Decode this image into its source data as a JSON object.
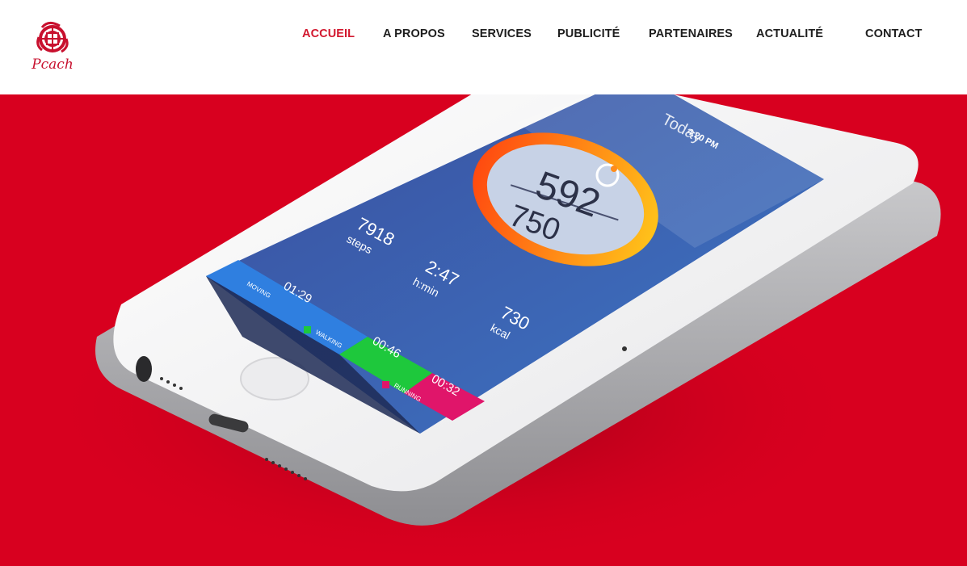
{
  "brand": {
    "logo_text": "Pcach",
    "logo_icon": "red-globe-logo-icon",
    "accent_color": "#d2172e",
    "hero_color": "#d8001f"
  },
  "nav": {
    "items": [
      {
        "label": "ACCUEIL",
        "active": true
      },
      {
        "label": "A PROPOS",
        "active": false
      },
      {
        "label": "SERVICES",
        "active": false
      },
      {
        "label": "PUBLICITÉ",
        "active": false
      },
      {
        "label": "PARTENAIRES",
        "active": false
      },
      {
        "label": "ACTUALITÉ",
        "active": false
      },
      {
        "label": "CONTACT",
        "active": false
      }
    ]
  },
  "hero": {
    "image": "fitness-app-smartphone",
    "phone_screen": {
      "status_time": "4:20 PM",
      "title": "Today",
      "score_current": "592",
      "score_goal": "750",
      "steps_value": "7918",
      "steps_label": "steps",
      "time_value": "2:47",
      "time_label": "h:min",
      "kcal_value": "730",
      "kcal_label": "kcal",
      "activities": [
        {
          "name": "MOVING",
          "duration": "01:29",
          "color": "#2f7fe0"
        },
        {
          "name": "WALKING",
          "duration": "00:46",
          "color": "#1ec83c"
        },
        {
          "name": "RUNNING",
          "duration": "00:32",
          "color": "#e0156a"
        }
      ]
    }
  }
}
